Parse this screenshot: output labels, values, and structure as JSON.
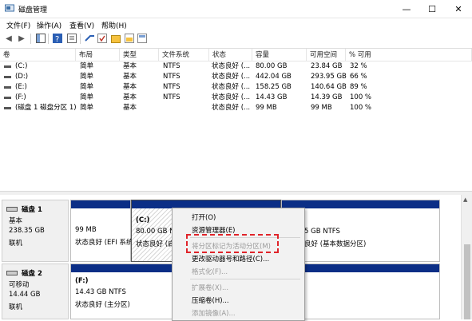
{
  "window": {
    "title": "磁盘管理",
    "minimize": "—",
    "maximize": "☐",
    "close": "✕"
  },
  "menu": [
    "文件(F)",
    "操作(A)",
    "查看(V)",
    "帮助(H)"
  ],
  "columns": [
    "卷",
    "布局",
    "类型",
    "文件系统",
    "状态",
    "容量",
    "可用空间",
    "% 可用"
  ],
  "volumes": [
    {
      "name": "(C:)",
      "layout": "简单",
      "type": "基本",
      "fs": "NTFS",
      "status": "状态良好 (...",
      "capacity": "80.00 GB",
      "free": "23.84 GB",
      "pct": "32 %"
    },
    {
      "name": "(D:)",
      "layout": "简单",
      "type": "基本",
      "fs": "NTFS",
      "status": "状态良好 (...",
      "capacity": "442.04 GB",
      "free": "293.95 GB",
      "pct": "66 %"
    },
    {
      "name": "(E:)",
      "layout": "简单",
      "type": "基本",
      "fs": "NTFS",
      "status": "状态良好 (...",
      "capacity": "158.25 GB",
      "free": "140.64 GB",
      "pct": "89 %"
    },
    {
      "name": "(F:)",
      "layout": "简单",
      "type": "基本",
      "fs": "NTFS",
      "status": "状态良好 (...",
      "capacity": "14.43 GB",
      "free": "14.39 GB",
      "pct": "100 %"
    },
    {
      "name": "(磁盘 1 磁盘分区 1)",
      "layout": "简单",
      "type": "基本",
      "fs": "",
      "status": "状态良好 (...",
      "capacity": "99 MB",
      "free": "99 MB",
      "pct": "100 %"
    }
  ],
  "disk1": {
    "label": "磁盘 1",
    "type": "基本",
    "size": "238.35 GB",
    "status": "联机",
    "p_efi": {
      "size": "99 MB",
      "status": "状态良好 (EFI 系统"
    },
    "p_c": {
      "name": "(C:)",
      "size": "80.00 GB N",
      "status": "状态良好 (启"
    },
    "p_right": {
      "size": "5 GB NTFS",
      "status": "良好 (基本数据分区)"
    }
  },
  "disk2": {
    "label": "磁盘 2",
    "type": "可移动",
    "size": "14.44 GB",
    "status": "联机",
    "p_f": {
      "name": "(F:)",
      "size": "14.43 GB NTFS",
      "status": "状态良好 (主分区)"
    }
  },
  "context_menu": {
    "open": "打开(O)",
    "explorer": "资源管理器(E)",
    "mark_active": "将分区标记为活动分区(M)",
    "change_letter": "更改驱动器号和路径(C)...",
    "format": "格式化(F)...",
    "extend": "扩展卷(X)...",
    "shrink": "压缩卷(H)...",
    "mirror": "添加镜像(A)..."
  },
  "colors": {
    "partition_bar": "#0b2e86",
    "highlight": "#e0242a"
  }
}
